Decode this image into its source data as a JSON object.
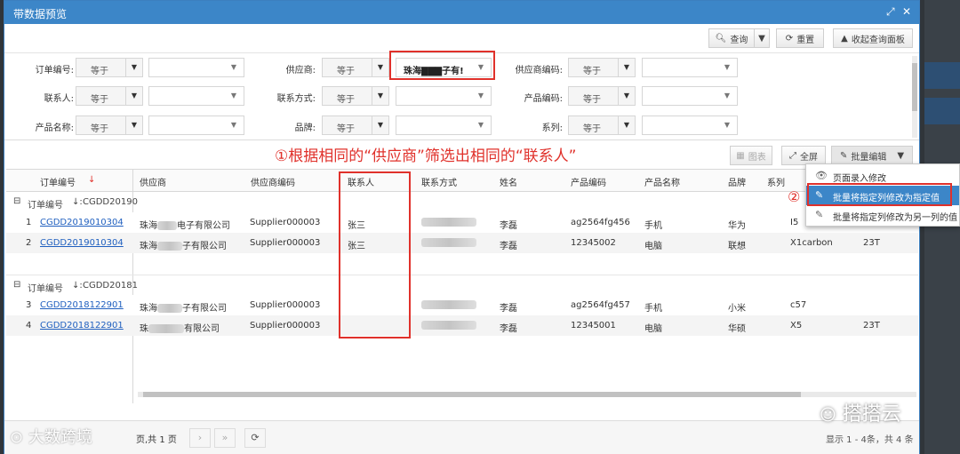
{
  "window": {
    "title": "带数据预览"
  },
  "toolbar": {
    "query": "查询",
    "reset": "重置",
    "collapse": "收起查询面板"
  },
  "filters": {
    "order_no": {
      "label": "订单编号:",
      "op": "等于"
    },
    "supplier": {
      "label": "供应商:",
      "op": "等于",
      "value": "珠海▇▇▇子有!"
    },
    "supplier_code": {
      "label": "供应商编码:",
      "op": "等于"
    },
    "contact": {
      "label": "联系人:",
      "op": "等于"
    },
    "contact_method": {
      "label": "联系方式:",
      "op": "等于"
    },
    "product_code": {
      "label": "产品编码:",
      "op": "等于"
    },
    "product_name": {
      "label": "产品名称:",
      "op": "等于"
    },
    "brand": {
      "label": "品牌:",
      "op": "等于"
    },
    "series": {
      "label": "系列:",
      "op": "等于"
    }
  },
  "annotation": {
    "step1": "①根据相同的“供应商”筛选出相同的“联系人”",
    "step2": "②"
  },
  "grid_toolbar": {
    "chart": "图表",
    "fullscreen": "全屏",
    "batch_edit": "批量编辑"
  },
  "batch_menu": [
    "页面录入修改",
    "批量将指定列修改为指定值",
    "批量将指定列修改为另一列的值"
  ],
  "columns": [
    "订单编号",
    "供应商",
    "供应商编码",
    "联系人",
    "联系方式",
    "姓名",
    "产品编码",
    "产品名称",
    "品牌",
    "系列"
  ],
  "groups": [
    {
      "label": "订单编号",
      "value": "CGDD20190"
    },
    {
      "label": "订单编号",
      "value": "CGDD20181"
    }
  ],
  "rows": [
    {
      "num": "1",
      "order": "CGDD2019010304",
      "supplier_a": "珠海",
      "supplier_b": "电子有限公司",
      "code": "Supplier000003",
      "contact": "张三",
      "name": "李磊",
      "pcode": "ag2564fg456",
      "pname": "手机",
      "brand": "华为",
      "series": "I5",
      "extra": ""
    },
    {
      "num": "2",
      "order": "CGDD2019010304",
      "supplier_a": "珠海",
      "supplier_b": "子有限公司",
      "code": "Supplier000003",
      "contact": "张三",
      "name": "李磊",
      "pcode": "12345002",
      "pname": "电脑",
      "brand": "联想",
      "series": "X1carbon",
      "extra": "23T"
    },
    {
      "num": "3",
      "order": "CGDD2018122901",
      "supplier_a": "珠海",
      "supplier_b": "子有限公司",
      "code": "Supplier000003",
      "contact": "",
      "name": "李磊",
      "pcode": "ag2564fg457",
      "pname": "手机",
      "brand": "小米",
      "series": "c57",
      "extra": ""
    },
    {
      "num": "4",
      "order": "CGDD2018122901",
      "supplier_a": "珠",
      "supplier_b": "有限公司",
      "code": "Supplier000003",
      "contact": "",
      "name": "李磊",
      "pcode": "12345001",
      "pname": "电脑",
      "brand": "华硕",
      "series": "X5",
      "extra": "23T"
    }
  ],
  "footer": {
    "page_text": "页,共 1 页",
    "summary": "显示 1 - 4条，共 4 条"
  },
  "watermark": {
    "left": "大数跨境",
    "right": "搭搭云"
  }
}
